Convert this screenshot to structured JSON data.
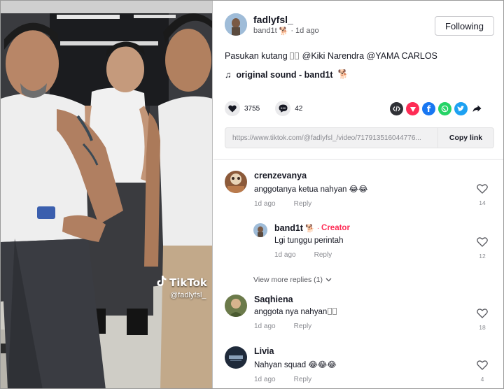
{
  "video": {
    "watermark_brand": "TikTok",
    "watermark_handle": "@fadlyfsl_"
  },
  "author": {
    "username": "fadlyfsl_",
    "nickname": "band1t",
    "time": "1d ago",
    "follow_label": "Following"
  },
  "description": {
    "text": "Pasukan kutang",
    "mentions": "@Kiki Narendra @YAMA CARLOS"
  },
  "music": {
    "label": "original sound - band1t"
  },
  "stats": {
    "likes": "3755",
    "comments": "42"
  },
  "share_icons": [
    "embed-icon",
    "send-icon",
    "facebook-icon",
    "whatsapp-icon",
    "twitter-icon",
    "share-arrow-icon"
  ],
  "link": {
    "url": "https://www.tiktok.com/@fadlyfsl_/video/717913516044776...",
    "copy_label": "Copy link"
  },
  "comments": [
    {
      "user": "crenzevanya",
      "text": "anggotanya ketua nahyan 😂😂",
      "time": "1d ago",
      "reply_label": "Reply",
      "likes": "14"
    },
    {
      "user": "band1t",
      "badge": "Creator",
      "text": "Lgi tunggu perintah",
      "time": "1d ago",
      "reply_label": "Reply",
      "likes": "12"
    },
    {
      "user": "Saqhiena",
      "text": "anggota nya nahyan",
      "time": "1d ago",
      "reply_label": "Reply",
      "likes": "18"
    },
    {
      "user": "Livia",
      "text": "Nahyan squad 😂😂😂",
      "time": "1d ago",
      "reply_label": "Reply",
      "likes": "4"
    }
  ],
  "view_more": {
    "label": "View more replies (1)"
  },
  "colors": {
    "accent": "#fe2c55",
    "text": "#161823",
    "muted": "#8a8b91"
  }
}
